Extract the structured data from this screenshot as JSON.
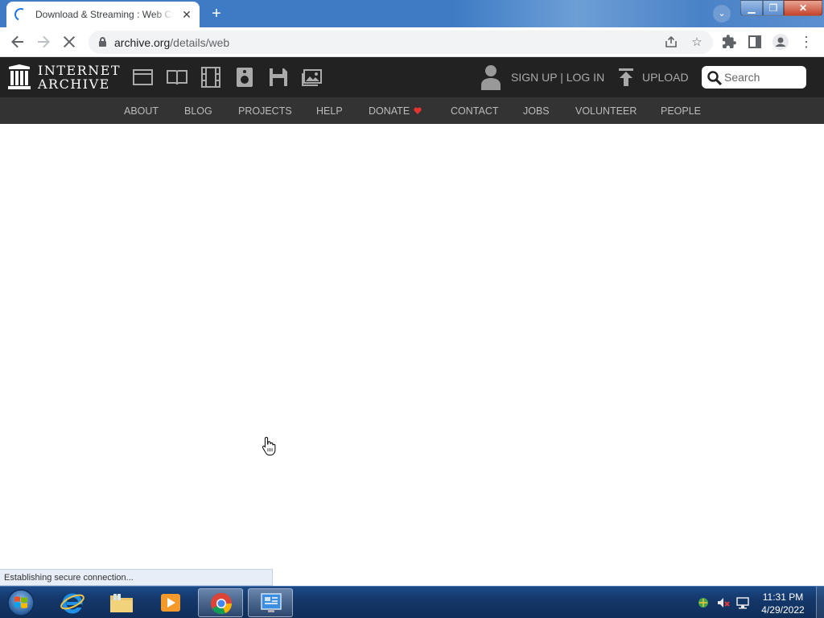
{
  "browser": {
    "tab_title": "Download & Streaming : Web Cr",
    "tab_close_icon": "close-icon",
    "new_tab_icon": "plus-icon",
    "url_host": "archive.org",
    "url_path": "/details/web",
    "window_controls": [
      "minimize",
      "maximize",
      "close"
    ]
  },
  "site": {
    "logo_line1": "INTERNET",
    "logo_line2": "ARCHIVE",
    "media_icons": [
      "web-icon",
      "texts-icon",
      "video-icon",
      "audio-icon",
      "software-icon",
      "images-icon"
    ],
    "signup_login": "SIGN UP | LOG IN",
    "upload": "UPLOAD",
    "search_placeholder": "Search",
    "nav": [
      "ABOUT",
      "BLOG",
      "PROJECTS",
      "HELP",
      "DONATE",
      "CONTACT",
      "JOBS",
      "VOLUNTEER",
      "PEOPLE"
    ],
    "donate_heart_color": "#e3342f"
  },
  "status": {
    "message": "Establishing secure connection..."
  },
  "taskbar": {
    "apps": [
      "internet-explorer",
      "file-explorer",
      "media-player",
      "chrome",
      "control-panel"
    ],
    "active_app": "chrome",
    "time": "11:31 PM",
    "date": "4/29/2022"
  },
  "colors": {
    "ia_header": "#222222",
    "ia_nav": "#333333",
    "chrome_accent": "#1a73e8"
  }
}
